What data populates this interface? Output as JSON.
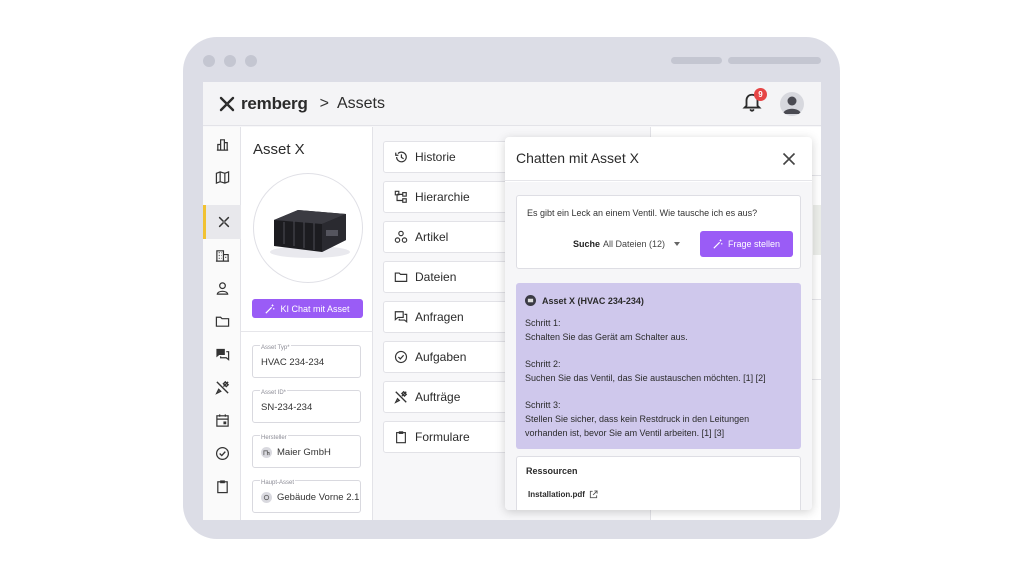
{
  "app": {
    "brand": "remberg",
    "breadcrumb_separator": ">",
    "breadcrumb": "Assets",
    "notification_count": "9"
  },
  "sidebar": {
    "items": [
      {
        "icon": "dashboard-icon",
        "active": false
      },
      {
        "icon": "map-icon",
        "active": false
      },
      {
        "icon": "assets-icon",
        "active": true
      },
      {
        "icon": "organizations-icon",
        "active": false
      },
      {
        "icon": "contacts-icon",
        "active": false
      },
      {
        "icon": "folder-icon",
        "active": false
      },
      {
        "icon": "chat-icon",
        "active": false
      },
      {
        "icon": "tools-icon",
        "active": false
      },
      {
        "icon": "calendar-icon",
        "active": false
      },
      {
        "icon": "check-icon",
        "active": false
      },
      {
        "icon": "clipboard-icon",
        "active": false
      }
    ]
  },
  "asset": {
    "title": "Asset X",
    "ki_button": "KI Chat mit Asset",
    "fields": [
      {
        "label": "Asset Typ*",
        "value": "HVAC 234-234"
      },
      {
        "label": "Asset ID*",
        "value": "SN-234-234"
      },
      {
        "label": "Hersteller",
        "value": "Maier GmbH"
      },
      {
        "label": "Haupt-Asset",
        "value": "Gebäude Vorne 2.1"
      }
    ]
  },
  "menu": {
    "items": [
      {
        "label": "Historie",
        "icon": "history-icon"
      },
      {
        "label": "Hierarchie",
        "icon": "hierarchy-icon"
      },
      {
        "label": "Artikel",
        "icon": "parts-icon"
      },
      {
        "label": "Dateien",
        "icon": "folder-icon"
      },
      {
        "label": "Anfragen",
        "icon": "requests-icon"
      },
      {
        "label": "Aufgaben",
        "icon": "tasks-icon"
      },
      {
        "label": "Aufträge",
        "icon": "work-orders-icon"
      },
      {
        "label": "Formulare",
        "icon": "forms-icon"
      }
    ]
  },
  "chat": {
    "title": "Chatten mit Asset X",
    "question": "Es gibt ein Leck an einem Ventil. Wie tausche ich es aus?",
    "search_label": "Suche",
    "search_value": "All Dateien (12)",
    "ask_button": "Frage stellen",
    "answer_header": "Asset X (HVAC 234-234)",
    "answer_lines": [
      "Schritt 1:",
      "Schalten Sie das Gerät am Schalter aus.",
      "Schritt 2:",
      "Suchen Sie das Ventil, das Sie austauschen möchten. [1] [2]",
      "Schritt 3:",
      "Stellen Sie sicher, dass kein Restdruck in den Leitungen",
      "vorhanden ist, bevor Sie am Ventil arbeiten. [1] [3]"
    ],
    "resources_title": "Ressourcen",
    "resource_link": "Installation.pdf"
  },
  "colors": {
    "accent": "#9a5cf6",
    "answer_bg": "#cfc8ec",
    "active_indicator": "#f1c232",
    "badge": "#e64545"
  }
}
